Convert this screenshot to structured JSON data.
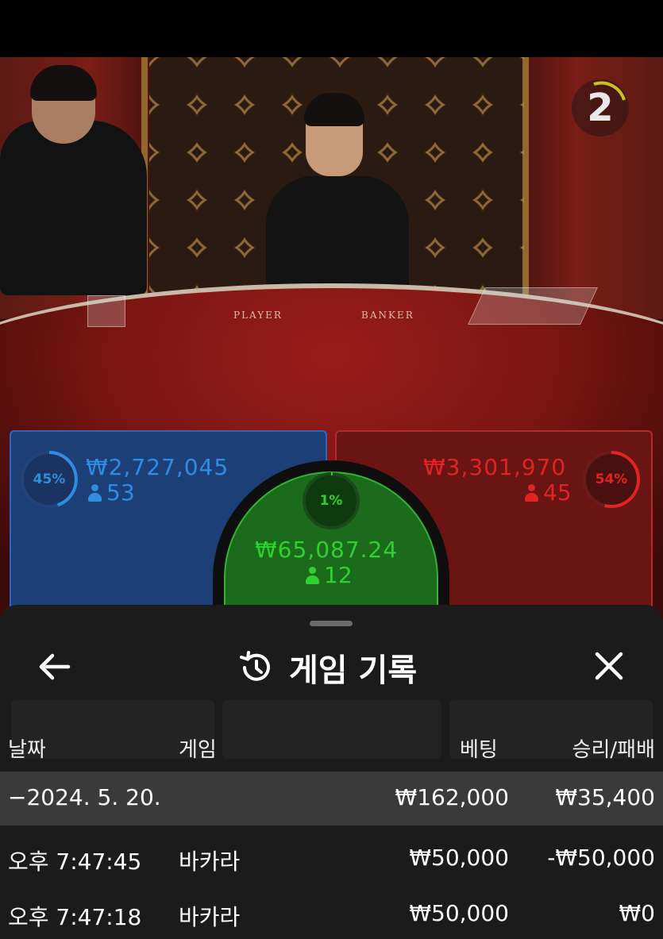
{
  "video": {
    "countdown": "2",
    "table_labels": [
      "PLAYER",
      "BANKER"
    ]
  },
  "bets": {
    "player": {
      "percent": "45%",
      "amount": "₩2,727,045",
      "players": "53",
      "color": "#2e8de0"
    },
    "banker": {
      "percent": "54%",
      "amount": "₩3,301,970",
      "players": "45",
      "color": "#e02424"
    },
    "tie": {
      "percent": "1%",
      "amount": "₩65,087.24",
      "players": "12",
      "color": "#2fd12f"
    }
  },
  "history_sheet": {
    "title": "게임 기록",
    "icons": {
      "back": "arrow-left-icon",
      "history": "history-icon",
      "close": "close-icon"
    },
    "columns": [
      "날짜",
      "게임",
      "베팅",
      "승리/패배"
    ],
    "date_group": {
      "date": "−2024. 5. 20.",
      "bet": "₩162,000",
      "result": "₩35,400"
    },
    "rows": [
      {
        "time": "오후 7:47:45",
        "game": "바카라",
        "bet": "₩50,000",
        "result": "-₩50,000"
      },
      {
        "time": "오후 7:47:18",
        "game": "바카라",
        "bet": "₩50,000",
        "result": "₩0"
      }
    ]
  }
}
